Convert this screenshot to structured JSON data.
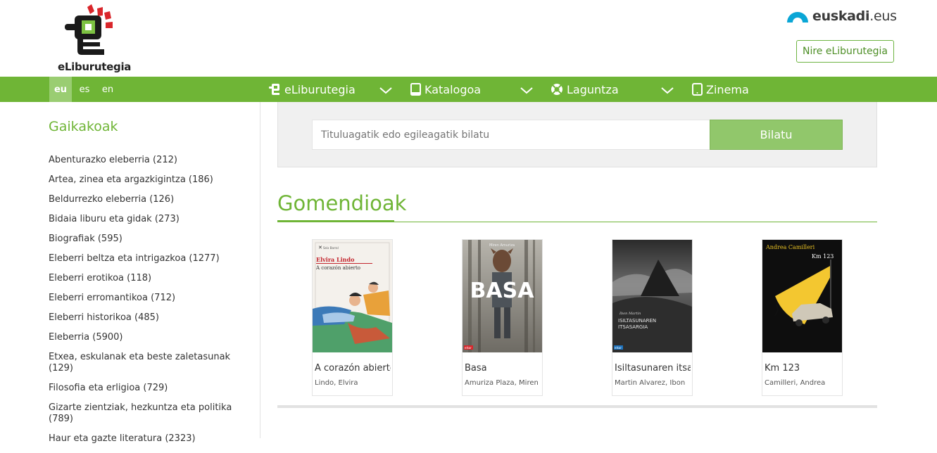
{
  "header": {
    "logo_text": "eLiburutegia",
    "euskadi_bold": "euskadi",
    "euskadi_light": ".eus",
    "nire_button": "Nire eLiburutegia"
  },
  "languages": [
    {
      "code": "eu",
      "active": true
    },
    {
      "code": "es",
      "active": false
    },
    {
      "code": "en",
      "active": false
    }
  ],
  "nav": [
    {
      "label": "eLiburutegia",
      "icon": "library-icon"
    },
    {
      "label": "Katalogoa",
      "icon": "tablet-icon"
    },
    {
      "label": "Laguntza",
      "icon": "lifebuoy-icon"
    },
    {
      "label": "Zinema",
      "icon": "device-icon"
    }
  ],
  "sidebar": {
    "title": "Gaikakoak",
    "categories": [
      "Abenturazko eleberria (212)",
      "Artea, zinea eta argazkigintza (186)",
      "Beldurrezko eleberria (126)",
      "Bidaia liburu eta gidak (273)",
      "Biografiak (595)",
      "Eleberri beltza eta intrigazkoa (1277)",
      "Eleberri erotikoa (118)",
      "Eleberri erromantikoa (712)",
      "Eleberri historikoa (485)",
      "Eleberria (5900)",
      "Etxea, eskulanak eta beste zaletasunak (129)",
      "Filosofia eta erligioa (729)",
      "Gizarte zientziak, hezkuntza eta politika (789)",
      "Haur eta gazte literatura (2323)"
    ]
  },
  "search": {
    "placeholder": "Tituluagatik edo egileagatik bilatu",
    "button": "Bilatu"
  },
  "recommendations": {
    "title": "Gomendioak",
    "books": [
      {
        "title": "A corazón abierto",
        "author": "Lindo, Elvira",
        "cover_author": "Elvira Lindo",
        "cover_title": "A corazón abierto",
        "cover_publisher": "Seix Barral"
      },
      {
        "title": "Basa",
        "author": "Amuriza Plaza, Miren",
        "cover_title": "BASA",
        "cover_author": "Miren Amuriza",
        "cover_publisher": "elkar"
      },
      {
        "title": "Isiltasunaren itsasargia",
        "author": "Martin Alvarez, Ibon",
        "cover_author": "Ibon Martin",
        "cover_title": "ISILTASUNAREN ITSASARGIA",
        "cover_publisher": "elkar"
      },
      {
        "title": "Km 123",
        "author": "Camilleri, Andrea",
        "cover_author": "Andrea Camilleri",
        "cover_title": "Km 123"
      }
    ]
  }
}
